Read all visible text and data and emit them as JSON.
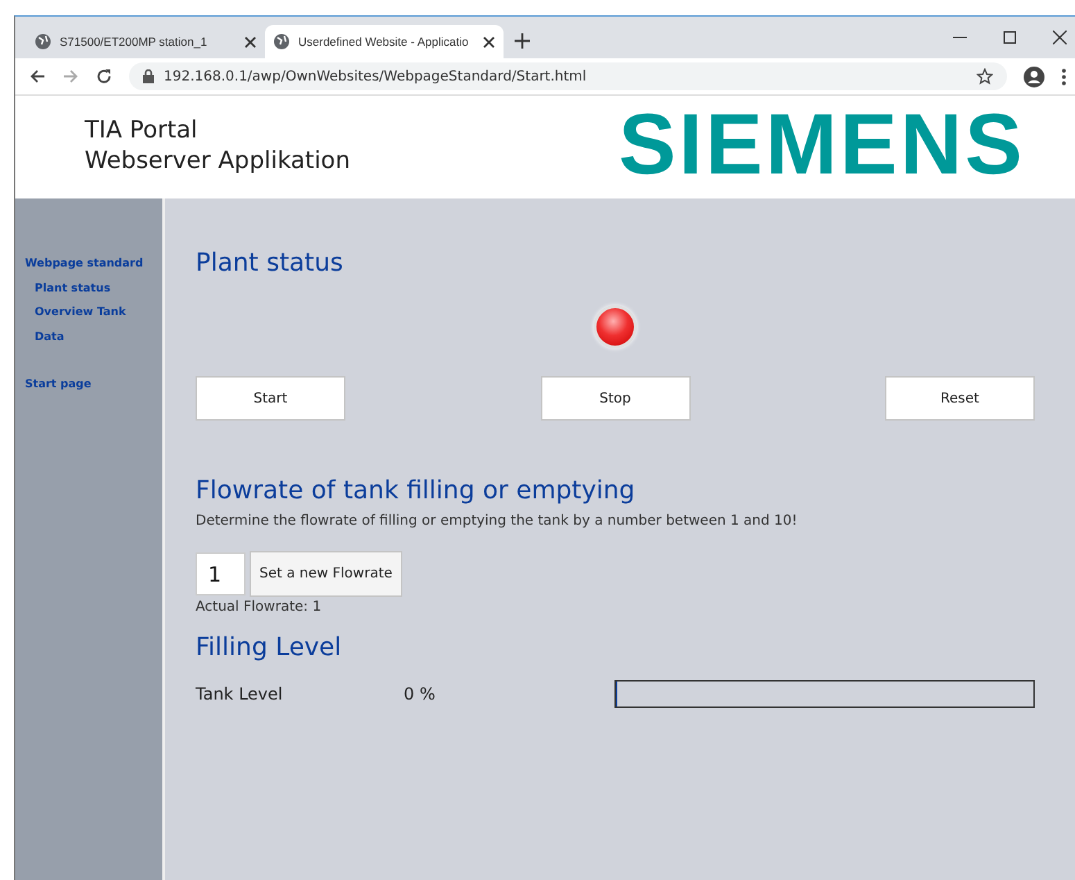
{
  "browser": {
    "tabs": [
      {
        "title": "S71500/ET200MP station_1",
        "selected": false
      },
      {
        "title": "Userdefined Website - Applicatio",
        "selected": true
      }
    ],
    "address": "192.168.0.1/awp/OwnWebsites/WebpageStandard/Start.html"
  },
  "header": {
    "title_lines": [
      "TIA Portal",
      "Webserver Applikation"
    ],
    "logo": "SIEMENS"
  },
  "sidebar": {
    "items": [
      {
        "label": "Webpage standard",
        "children": [
          {
            "label": "Plant status"
          },
          {
            "label": "Overview Tank"
          },
          {
            "label": "Data"
          }
        ]
      },
      {
        "label": "Start page"
      }
    ]
  },
  "plant_status": {
    "heading": "Plant status",
    "lamp_on": true,
    "buttons": [
      "Start",
      "Stop",
      "Reset"
    ]
  },
  "flowrate": {
    "heading": "Flowrate of tank filling or emptying",
    "description": "Determine the flowrate of filling or emptying the tank by a number between 1 and 10!",
    "value": "1",
    "button": "Set a new Flowrate",
    "actual": "Actual Flowrate: 1"
  },
  "filling": {
    "heading": "Filling Level",
    "label": "Tank Level",
    "reading": "0 %",
    "level": 0
  }
}
